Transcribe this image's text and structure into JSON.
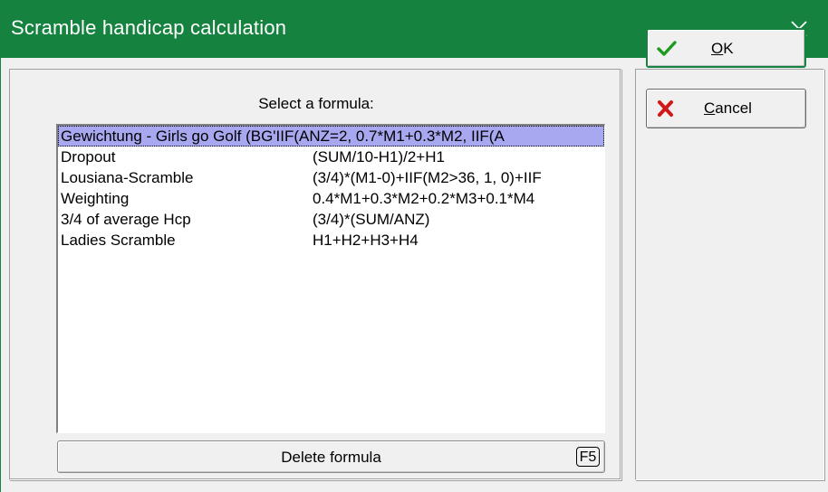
{
  "window": {
    "title": "Scramble handicap calculation",
    "close_glyph": "✕"
  },
  "formula_list": {
    "caption": "Select a formula:",
    "items": [
      {
        "name": "Gewichtung - Girls go Golf (BG'IIF(ANZ=2, 0.7*M1+0.3*M2, IIF(A",
        "formula": "",
        "selected": true
      },
      {
        "name": "Dropout",
        "formula": "(SUM/10-H1)/2+H1"
      },
      {
        "name": "Lousiana-Scramble",
        "formula": "(3/4)*(M1-0)+IIF(M2>36, 1, 0)+IIF"
      },
      {
        "name": "Weighting",
        "formula": "0.4*M1+0.3*M2+0.2*M3+0.1*M4"
      },
      {
        "name": "3/4 of average Hcp",
        "formula": "(3/4)*(SUM/ANZ)"
      },
      {
        "name": "Ladies Scramble",
        "formula": "H1+H2+H3+H4"
      }
    ]
  },
  "delete_button": {
    "label": "Delete formula",
    "shortcut": "F5"
  },
  "ok_button": {
    "accel": "O",
    "rest": "K",
    "icon": "checkmark-icon"
  },
  "cancel_button": {
    "accel": "C",
    "rest": "ancel",
    "icon": "red-x-icon"
  },
  "colors": {
    "title_bar": "#15833f",
    "selection": "#a8a8f0",
    "check_green": "#1f9a1f",
    "cancel_red": "#d01818"
  }
}
